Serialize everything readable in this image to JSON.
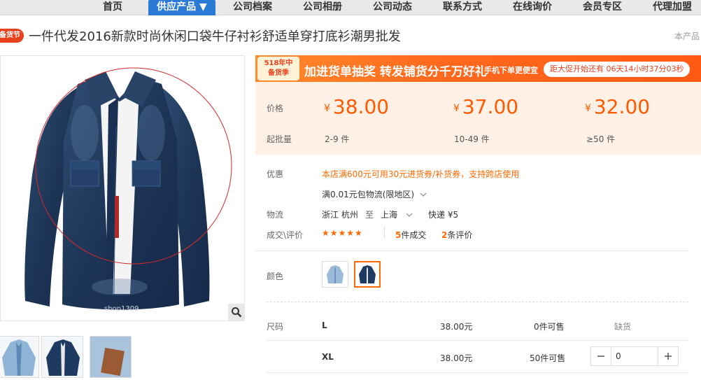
{
  "nav": {
    "items": [
      "首页",
      "供应产品 ▼",
      "公司档案",
      "公司相册",
      "公司动态",
      "联系方式",
      "在线询价",
      "会员专区",
      "代理加盟"
    ]
  },
  "product": {
    "hot_badge": "备货节",
    "title": "一件代发2016新款时尚休闲口袋牛仔衬衫舒适单穿打底衫潮男批发",
    "this_product": "本产品",
    "watermark": "shop1309"
  },
  "promo": {
    "tag_line1": "518年中",
    "tag_line2": "备货季",
    "headline": "加进货单抽奖 转发铺货分千万好礼",
    "sub": "手机下单更便宜",
    "countdown": "距大促开始还有 06天14小时37分03秒"
  },
  "pricing": {
    "price_label": "价格",
    "moq_label": "起批量",
    "currency": "¥",
    "tiers": [
      {
        "price": "38.00",
        "qty": "2-9 件"
      },
      {
        "price": "37.00",
        "qty": "10-49 件"
      },
      {
        "price": "32.00",
        "qty": "≥50 件"
      }
    ]
  },
  "offers": {
    "label": "优惠",
    "coupon": "本店满600元可用30元进货券/补货券，支持跨店使用",
    "shipping_promo": "满0.01元包物流(限地区)"
  },
  "logistics": {
    "label": "物流",
    "from": "浙江 杭州",
    "to_word": "至",
    "to": "上海",
    "express": "快递 ¥5"
  },
  "reviews": {
    "label": "成交\\评价",
    "stars": "★★★★★",
    "deals_count": "5",
    "deals_text": "件成交",
    "reviews_count": "2",
    "reviews_text": "条评价"
  },
  "color": {
    "label": "颜色"
  },
  "sizes": {
    "label": "尺码",
    "rows": [
      {
        "size": "L",
        "price": "38.00元",
        "stock": "0件可售",
        "status": "缺货"
      },
      {
        "size": "XL",
        "price": "38.00元",
        "stock": "50件可售",
        "qty": "0"
      }
    ]
  },
  "colors": {
    "accent": "#ff6a00",
    "nav_active": "#2b7bd6",
    "price_bg": "#fff1e6"
  }
}
